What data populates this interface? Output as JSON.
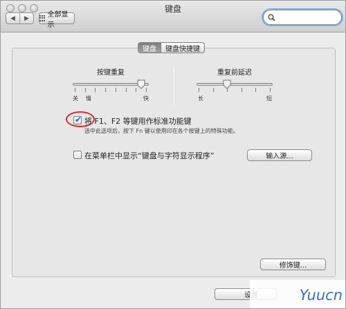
{
  "window": {
    "title": "键盘"
  },
  "toolbar": {
    "back_glyph": "◀",
    "forward_glyph": "▶",
    "show_all_label": "全部显示",
    "search": {
      "value": "",
      "placeholder": ""
    }
  },
  "tabs": [
    {
      "label": "键盘",
      "active": true
    },
    {
      "label": "键盘快捷键",
      "active": false
    }
  ],
  "sliders": {
    "key_repeat": {
      "title": "按键重复",
      "labels": [
        "关",
        "慢",
        "快"
      ],
      "level": 0.9
    },
    "delay_until_repeat": {
      "title": "重复前延迟",
      "labels": [
        "长",
        "短"
      ],
      "level": 0.4
    }
  },
  "options": {
    "fn_keys": {
      "checked": true,
      "label": "将 F1、F2 等键用作标准功能键",
      "description": "选中此选项后，按下 Fn 键以使用印在各个按键上的特殊功能。"
    },
    "menu_bar_viewer": {
      "checked": false,
      "label": "在菜单栏中显示“键盘与字符显示程序”"
    }
  },
  "buttons": {
    "input_sources": "输入源...",
    "modifier_keys": "修饰键...",
    "setup_assistant_partial": "设置"
  },
  "watermark": {
    "text": "Yuucn"
  },
  "colors": {
    "accent": "#2a5fb8",
    "annotation_ring": "#d22a2a",
    "watermark": "#3b6fb6"
  }
}
